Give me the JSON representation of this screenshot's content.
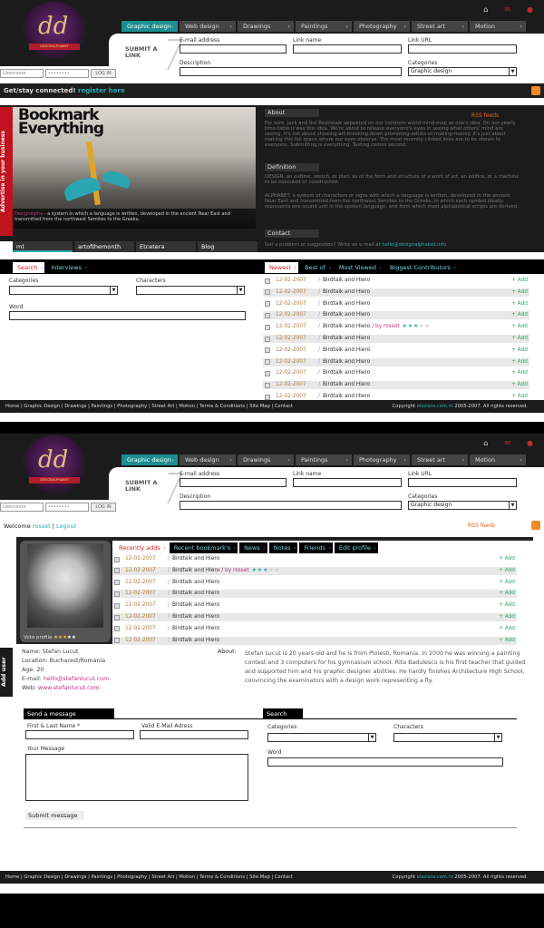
{
  "screen1": {
    "logo_letters": "dd",
    "logo_ribbon": "DESIGNALPHABET",
    "top_icons": [
      "home-icon",
      "mail-icon",
      "user-icon"
    ],
    "categories": [
      "Graphic design",
      "Web design",
      "Drawings",
      "Paintings",
      "Photography",
      "Street art",
      "Motion"
    ],
    "active_category": "Graphic design",
    "submit_link": "SUBMIT A LINK",
    "form": {
      "email_label": "E-mail address",
      "linkname_label": "Link name",
      "linkurl_label": "Link URL",
      "description_label": "Description",
      "categories_label": "Categories",
      "categories_value": "Graphic design"
    },
    "login": {
      "username_placeholder": "Username",
      "password_placeholder": "••••••••",
      "button": "LOG IN"
    },
    "connected": {
      "prefix": "Get/stay connected!",
      "link": "register here"
    },
    "hero": {
      "title_line1": "Bookmark",
      "title_line2": "Everything",
      "caption_highlight": "Designalpha",
      "caption": "- a system in which a language is written, developed in the ancient Near East and transmitted from the northwest Semites to the Greeks;"
    },
    "side_tab": "Advertise in your business",
    "hero_tabs": [
      "mt",
      "artofthemonth",
      "Etcetera",
      "Blog"
    ],
    "about": {
      "title": "About",
      "rss": "RSS feeds",
      "text": "For sure, Jack and the Beanstalk appeared on our common world-mind-map as one's idea. On our yearly time-table it was this idea. We're about to release everyone's eyes in seeing what others' mind are seeing. It's not about showing-art-breaking-down-promoting-artists-or-making-money. It's just about making this fall space where our eyes observe. The most recently-clicked links are to be shown to everyone. Submitting is everything. Tasting comes second."
    },
    "definition": {
      "title": "Definition",
      "text1": "DESIGN: an outline, sketch, or plan, as of the form and structure of a work of art, an edifice, or a machine to be executed or constructed.",
      "text2": "ALPHABET: a system of characters or signs with which a language is written, developed in the ancient Near East and transmitted from the northwest Semites to the Greeks; in which each symbol ideally represents one sound unit in the spoken language, and from which most alphabetical scripts are derived."
    },
    "contact": {
      "title": "Contact",
      "text": "Got a problem or suggestion? Write an e-mail at",
      "email": "hello@designalphabet.info"
    },
    "search_tabs": [
      "Search",
      "Interviews"
    ],
    "search": {
      "categories_label": "Categories",
      "characters_label": "Characters",
      "word_label": "Word"
    },
    "list_tabs": [
      "Newest",
      "Best of",
      "Most Viewed",
      "Biggest Contributors"
    ],
    "list_items": [
      {
        "date": "12-02-2007",
        "title": "Birdtalk and Hiero",
        "add": "+ Add"
      },
      {
        "date": "12-02-2007",
        "title": "Birdtalk and Hiero",
        "add": "+ Add"
      },
      {
        "date": "12-02-2007",
        "title": "Birdtalk and Hiero",
        "add": "+ Add"
      },
      {
        "date": "12-02-2007",
        "title": "Birdtalk and Hiero",
        "add": "+ Add"
      },
      {
        "date": "12-02-2007",
        "title": "Birdtalk and Hiero",
        "by": "/ by rosset",
        "rating": 3,
        "add": "+ Add"
      },
      {
        "date": "12-02-2007",
        "title": "Birdtalk and Hiero",
        "add": "+ Add"
      },
      {
        "date": "12-02-2007",
        "title": "Birdtalk and Hiero",
        "add": "+ Add"
      },
      {
        "date": "12-02-2007",
        "title": "Birdtalk and Hiero",
        "add": "+ Add"
      },
      {
        "date": "12-02-2007",
        "title": "Birdtalk and Hiero",
        "add": "+ Add"
      },
      {
        "date": "12-02-2007",
        "title": "Birdtalk and Hiero",
        "add": "+ Add"
      },
      {
        "date": "12-02-2007",
        "title": "Birdtalk and Hiero",
        "add": "+ Add"
      }
    ],
    "footer_links": [
      "Home",
      "Graphic Design",
      "Drawings",
      "Paintings",
      "Photography",
      "Street Art",
      "Motion",
      "Terms & Conditions",
      "Site Map",
      "Contact"
    ],
    "footer_copy_prefix": "Copyright",
    "footer_copy_link": "elsalara.com.ro",
    "footer_copy_suffix": "2005-2007. All rights reserved."
  },
  "screen2": {
    "welcome": {
      "prefix": "Welcome",
      "user": "rosset",
      "logout": "Logout"
    },
    "rss": "RSS feeds",
    "profile_tabs": [
      "Recently adds",
      "Recent bookmark's",
      "News",
      "Notes",
      "Friends",
      "Edit profile"
    ],
    "vote_label": "Vote profile",
    "rating": 3,
    "add_user": "Add user",
    "list_items": [
      {
        "date": "12-02-2007",
        "title": "Birdtalk and Hiero",
        "add": "+ Add"
      },
      {
        "date": "12-02-2007",
        "title": "Birdtalk and Hiero",
        "by": "/ by rosset",
        "rating": 3,
        "add": "+ Add"
      },
      {
        "date": "12-02-2007",
        "title": "Birdtalk and Hiero",
        "add": "+ Add"
      },
      {
        "date": "12-02-2007",
        "title": "Birdtalk and Hiero",
        "add": "+ Add"
      },
      {
        "date": "12-02-2007",
        "title": "Birdtalk and Hiero",
        "add": "+ Add"
      },
      {
        "date": "12-02-2007",
        "title": "Birdtalk and Hiero",
        "add": "+ Add"
      },
      {
        "date": "12-02-2007",
        "title": "Birdtalk and Hiero",
        "add": "+ Add"
      },
      {
        "date": "12-02-2007",
        "title": "Birdtalk and Hiero",
        "add": "+ Add"
      }
    ],
    "info": {
      "name_k": "Name:",
      "name_v": "Stefan Lucut",
      "location_k": "Location:",
      "location_v": "Bucharest/Romania",
      "age_k": "Age:",
      "age_v": "20",
      "email_k": "E-mail:",
      "email_v": "hello@stefanlucut.com",
      "web_k": "Web:",
      "web_v": "www.stefanlucut.com"
    },
    "about_k": "About:",
    "about_text": "Stefan Lucut is 20 years old and he is from Ploiesti, Romania. In 2000 he was winning a painting contest and 3 computers for his gymnasium school. Rita Badulescu is his first teacher that guided and supported him and his graphic designer abilities. He hardly finishes Architecture High School, convincing the examinators with a design work representing a fly.",
    "message": {
      "tab": "Send a message",
      "name_label": "First & Last Name *",
      "email_label": "Valid E-Mail Adress",
      "msg_label": "Your Message",
      "submit": "Submit message"
    },
    "search": {
      "tab": "Search",
      "categories_label": "Categories",
      "characters_label": "Characters",
      "word_label": "Word"
    }
  },
  "colors": {
    "accent": "#1c8e91",
    "link": "#c2337c",
    "dark": "#1b1b1b",
    "red": "#c1121f"
  }
}
